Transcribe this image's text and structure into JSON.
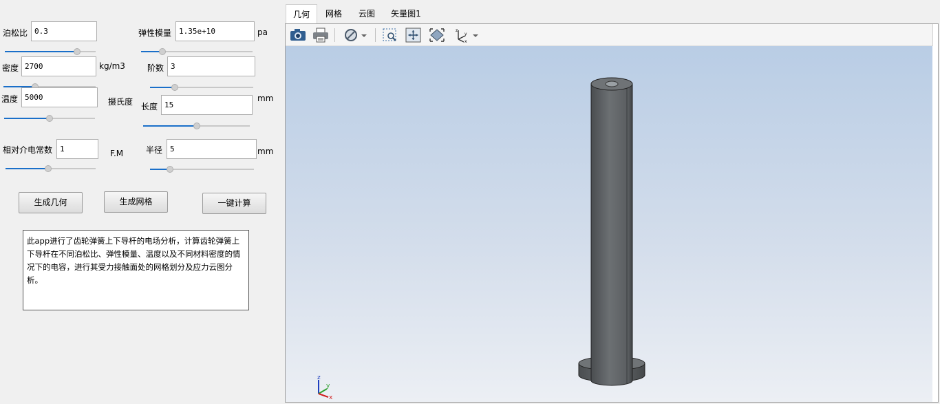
{
  "params": {
    "poisson": {
      "label": "泊松比",
      "value": "0.3",
      "slider": 0.82
    },
    "elastic": {
      "label": "弹性模量",
      "value": "1.35e+10",
      "unit": "pa",
      "slider": 0.17
    },
    "density": {
      "label": "密度",
      "value": "2700",
      "unit": "kg/m3",
      "slider": 0.33
    },
    "order": {
      "label": "阶数",
      "value": "3",
      "slider": 0.22
    },
    "temperature": {
      "label": "温度",
      "value": "5000",
      "unit": "摄氏度",
      "slider": 0.5
    },
    "length": {
      "label": "长度",
      "value": "15",
      "unit": "mm",
      "slider": 0.5
    },
    "permittivity": {
      "label": "相对介电常数",
      "value": "1",
      "unit": "F.M",
      "slider": 0.47
    },
    "radius": {
      "label": "半径",
      "value": "5",
      "unit": "mm",
      "slider": 0.17
    }
  },
  "buttons": {
    "gen_geometry": "生成几何",
    "gen_mesh": "生成网格",
    "compute": "一键计算"
  },
  "description": "此app进行了齿轮弹簧上下导杆的电场分析，计算齿轮弹簧上下导杆在不同泊松比、弹性模量、温度以及不同材料密度的情况下的电容，进行其受力接触面处的网格划分及应力云图分析。",
  "tabs": [
    "几何",
    "网格",
    "云图",
    "矢量图1"
  ],
  "active_tab": 0,
  "toolbar": {
    "icons": [
      "camera-icon",
      "print-icon",
      "hide-icon",
      "dropdown-arrow-icon",
      "zoom-box-icon",
      "zoom-extents-icon",
      "view-fit-icon",
      "axis-orientation-icon",
      "dropdown-arrow-icon"
    ]
  },
  "axis_triad": {
    "x": "x",
    "y": "y",
    "z": "z"
  },
  "colors": {
    "accent": "#1a6fc9",
    "background_top": "#b9cde5",
    "background_bottom": "#eceff4",
    "model": "#5f6264"
  }
}
